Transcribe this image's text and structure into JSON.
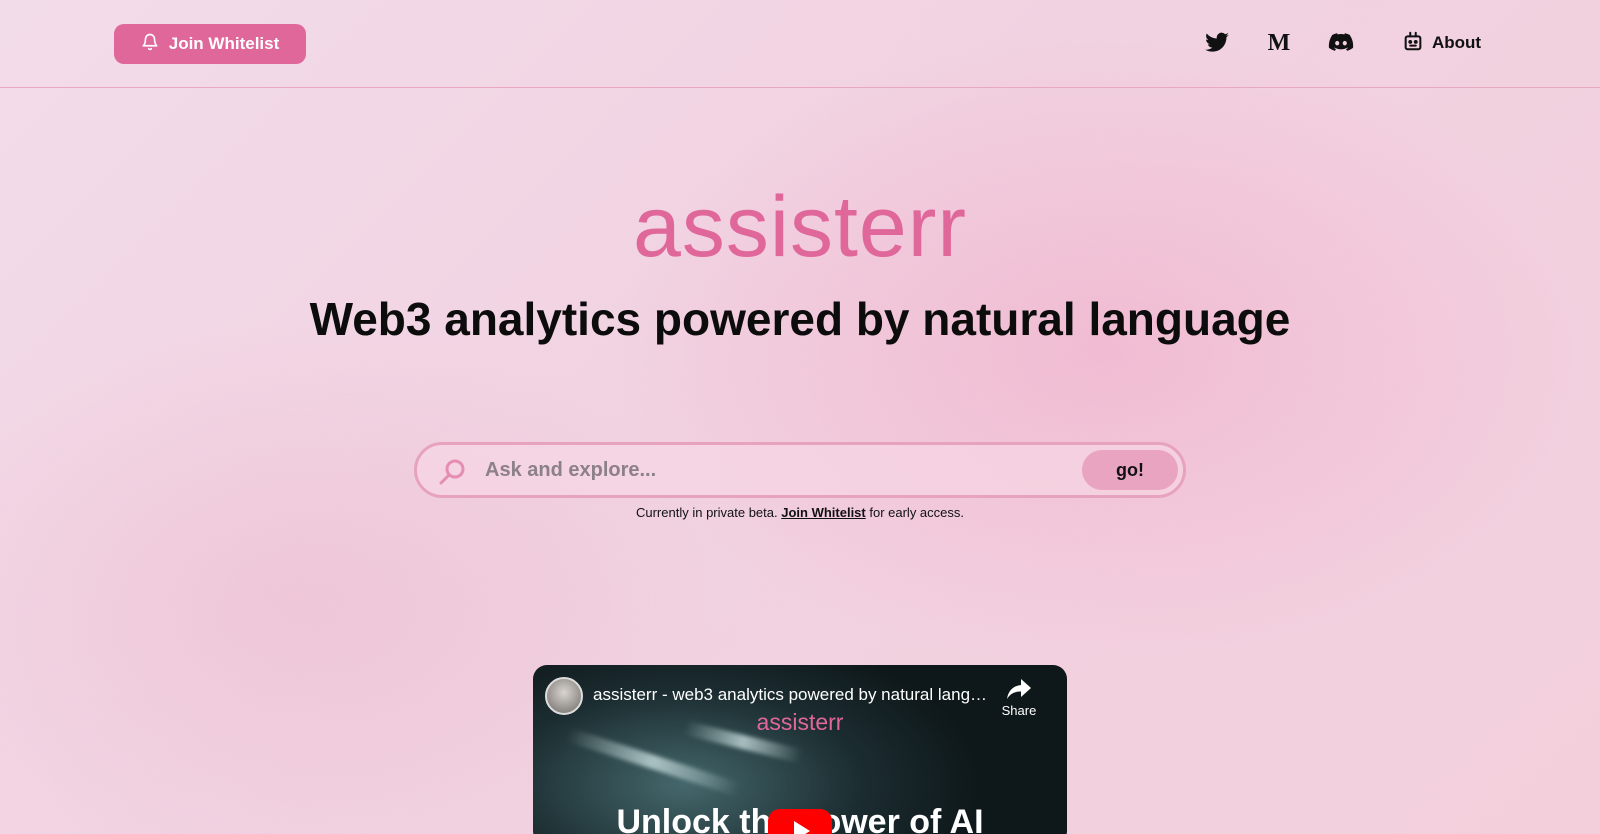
{
  "header": {
    "whitelist_label": "Join Whitelist",
    "nav_icons": [
      "twitter-icon",
      "medium-icon",
      "discord-icon"
    ],
    "medium_glyph": "M",
    "about_label": "About"
  },
  "hero": {
    "logo": "assisterr",
    "headline": "Web3 analytics powered by natural language"
  },
  "search": {
    "placeholder": "Ask and explore...",
    "go_label": "go!"
  },
  "beta_note": {
    "prefix": "Currently in private beta.",
    "link": "Join Whitelist",
    "suffix": "for early access."
  },
  "video": {
    "title": "assisterr - web3 analytics powered by natural langu...",
    "share_label": "Share",
    "brand": "assisterr",
    "overlay_text": "Unlock the power of AI"
  },
  "colors": {
    "accent": "#e0679a",
    "accent_light": "#e9a4c2",
    "text": "#111111"
  }
}
